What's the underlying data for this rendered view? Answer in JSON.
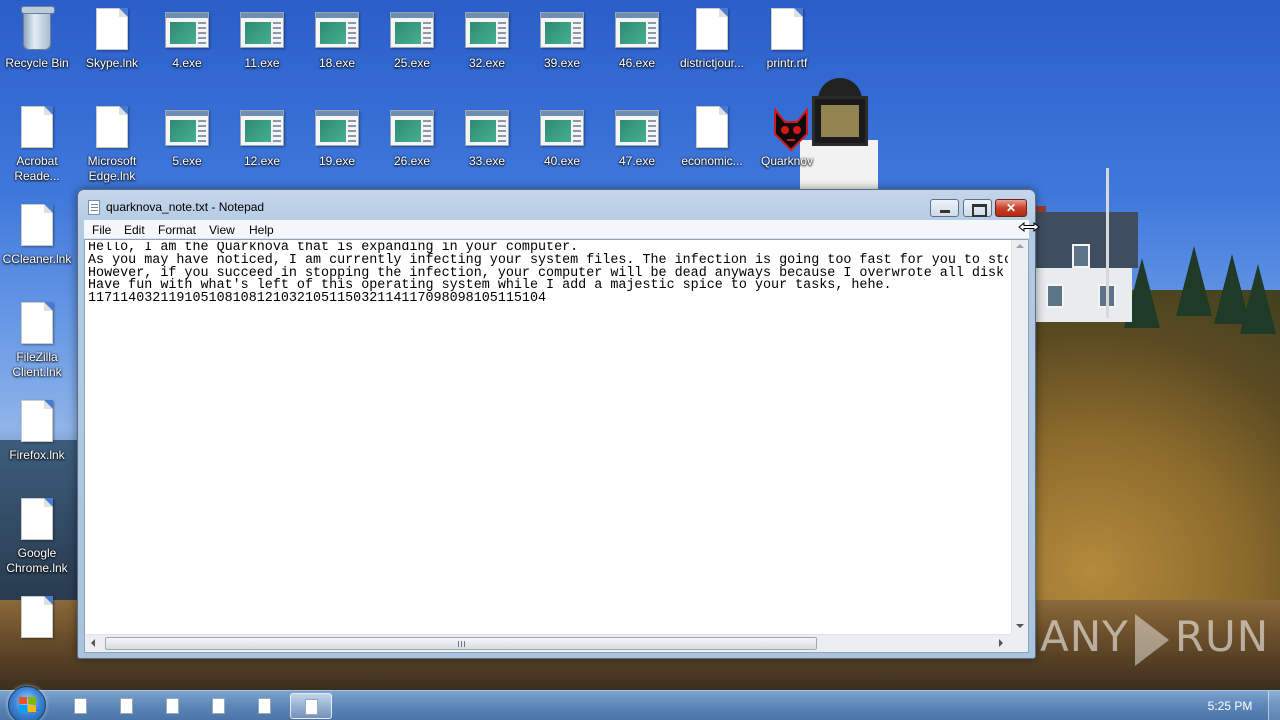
{
  "desktop": {
    "icons": [
      {
        "label": "Recycle Bin",
        "icon": "recycle-bin-icon"
      },
      {
        "label": "Skype.lnk",
        "icon": "document-icon"
      },
      {
        "label": "4.exe",
        "icon": "executable-icon"
      },
      {
        "label": "11.exe",
        "icon": "executable-icon"
      },
      {
        "label": "18.exe",
        "icon": "executable-icon"
      },
      {
        "label": "25.exe",
        "icon": "executable-icon"
      },
      {
        "label": "32.exe",
        "icon": "executable-icon"
      },
      {
        "label": "39.exe",
        "icon": "executable-icon"
      },
      {
        "label": "46.exe",
        "icon": "executable-icon"
      },
      {
        "label": "districtjour...",
        "icon": "document-icon"
      },
      {
        "label": "printr.rtf",
        "icon": "document-icon"
      },
      {
        "label": "Acrobat Reade...",
        "icon": "document-icon"
      },
      {
        "label": "Microsoft Edge.lnk",
        "icon": "document-icon"
      },
      {
        "label": "5.exe",
        "icon": "executable-icon"
      },
      {
        "label": "12.exe",
        "icon": "executable-icon"
      },
      {
        "label": "19.exe",
        "icon": "executable-icon"
      },
      {
        "label": "26.exe",
        "icon": "executable-icon"
      },
      {
        "label": "33.exe",
        "icon": "executable-icon"
      },
      {
        "label": "40.exe",
        "icon": "executable-icon"
      },
      {
        "label": "47.exe",
        "icon": "executable-icon"
      },
      {
        "label": "economic...",
        "icon": "document-icon"
      },
      {
        "label": "Quarknov",
        "icon": "fox-skull-icon"
      },
      {
        "label": "CCleaner.lnk",
        "icon": "document-icon"
      },
      {
        "label": "FileZilla Client.lnk",
        "icon": "document-icon"
      },
      {
        "label": "Firefox.lnk",
        "icon": "document-icon"
      },
      {
        "label": "Google Chrome.lnk",
        "icon": "document-icon"
      },
      {
        "label": "",
        "icon": "document-icon"
      }
    ]
  },
  "window": {
    "title": "quarknova_note.txt - Notepad",
    "menu": [
      "File",
      "Edit",
      "Format",
      "View",
      "Help"
    ],
    "close_glyph": "✕",
    "content": "Hello, I am the Quarknova that is expanding in your computer.\nAs you may have noticed, I am currently infecting your system files. The infection is going too fast for you to sto\nHowever, if you succeed in stopping the infection, your computer will be dead anyways because I overwrote all disk\nHave fun with what's left of this operating system while I add a majestic spice to your tasks, hehe.\n117114032119105108108121032105115032114117098098105115104"
  },
  "watermark": {
    "left": "ANY",
    "right": "RUN"
  },
  "taskbar": {
    "buttons": [
      {
        "name": "taskbar-item-1",
        "active": false
      },
      {
        "name": "taskbar-item-2",
        "active": false
      },
      {
        "name": "taskbar-item-3",
        "active": false
      },
      {
        "name": "taskbar-item-4",
        "active": false
      },
      {
        "name": "taskbar-item-5",
        "active": false
      },
      {
        "name": "taskbar-item-notepad",
        "active": true
      }
    ],
    "clock": "5:25 PM"
  },
  "colors": {
    "accent": "#3d86d6",
    "close_button": "#c8402a",
    "window_frame": "#b3cae3"
  }
}
